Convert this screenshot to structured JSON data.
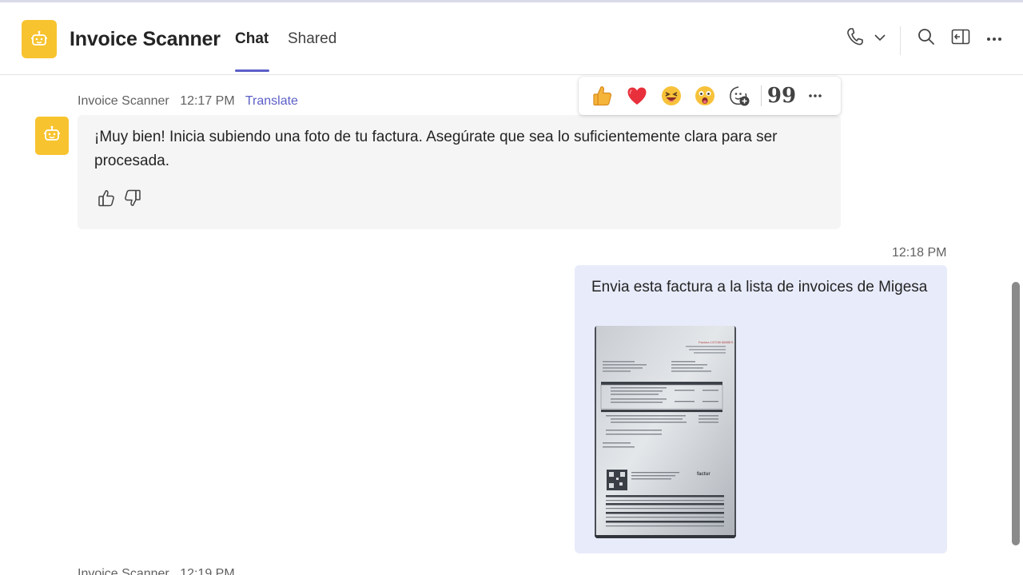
{
  "app": {
    "title": "Invoice Scanner",
    "icon": "bot-icon",
    "accent_color": "#5b5fc7",
    "icon_bg_color": "#f7c32f"
  },
  "tabs": [
    {
      "label": "Chat",
      "active": true
    },
    {
      "label": "Shared",
      "active": false
    }
  ],
  "header_actions": [
    "phone-icon",
    "chevron-down-icon",
    "search-icon",
    "popout-icon",
    "more-icon"
  ],
  "messages": [
    {
      "sender": "Invoice Scanner",
      "time": "12:17 PM",
      "translate": "Translate",
      "text": "¡Muy bien! Inicia subiendo una foto de tu factura. Asegúrate que sea lo suficientemente clara para ser procesada.",
      "feedback": [
        "thumbs-up-icon",
        "thumbs-down-icon"
      ]
    },
    {
      "outgoing": true,
      "time": "12:18 PM",
      "text": "Envia esta factura a la lista de invoices de Migesa",
      "attachment": "invoice-photo"
    },
    {
      "sender": "Invoice Scanner",
      "time": "12:19 PM"
    }
  ],
  "reactions": {
    "items": [
      "like",
      "heart",
      "laugh",
      "surprised",
      "add-reaction"
    ],
    "quote": "99",
    "more": "more-icon"
  }
}
